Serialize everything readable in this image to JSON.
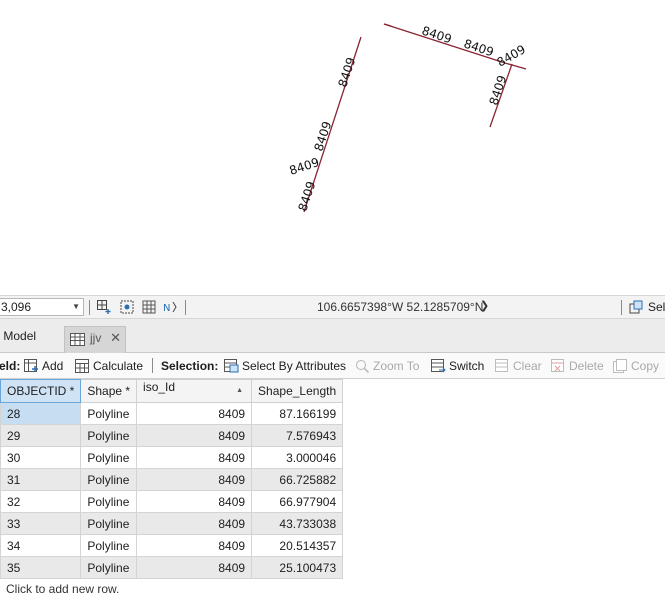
{
  "map": {
    "line_color": "#8a2434",
    "labels": [
      "8409",
      "8409",
      "8409",
      "8409",
      "8409",
      "8409",
      "8409",
      "8409"
    ]
  },
  "statusbar": {
    "scale": "3,096",
    "coordinates": "106.6657398°W 52.1285709°N",
    "selection_label": "Sele"
  },
  "tabs": [
    {
      "label": "Model"
    },
    {
      "label": "jjv"
    }
  ],
  "toolbar": {
    "field_label": "eld:",
    "add_label": "Add",
    "calculate_label": "Calculate",
    "selection_label": "Selection:",
    "select_by_attr_label": "Select By Attributes",
    "zoom_to_label": "Zoom To",
    "switch_label": "Switch",
    "clear_label": "Clear",
    "delete_label": "Delete",
    "copy_label": "Copy"
  },
  "table": {
    "columns": [
      "OBJECTID *",
      "Shape *",
      "iso_Id",
      "Shape_Length"
    ],
    "sort_indicator": "▲",
    "rows": [
      [
        "28",
        "Polyline",
        "8409",
        "87.166199"
      ],
      [
        "29",
        "Polyline",
        "8409",
        "7.576943"
      ],
      [
        "30",
        "Polyline",
        "8409",
        "3.000046"
      ],
      [
        "31",
        "Polyline",
        "8409",
        "66.725882"
      ],
      [
        "32",
        "Polyline",
        "8409",
        "66.977904"
      ],
      [
        "33",
        "Polyline",
        "8409",
        "43.733038"
      ],
      [
        "34",
        "Polyline",
        "8409",
        "20.514357"
      ],
      [
        "35",
        "Polyline",
        "8409",
        "25.100473"
      ]
    ],
    "add_row_text": "Click to add new row."
  }
}
